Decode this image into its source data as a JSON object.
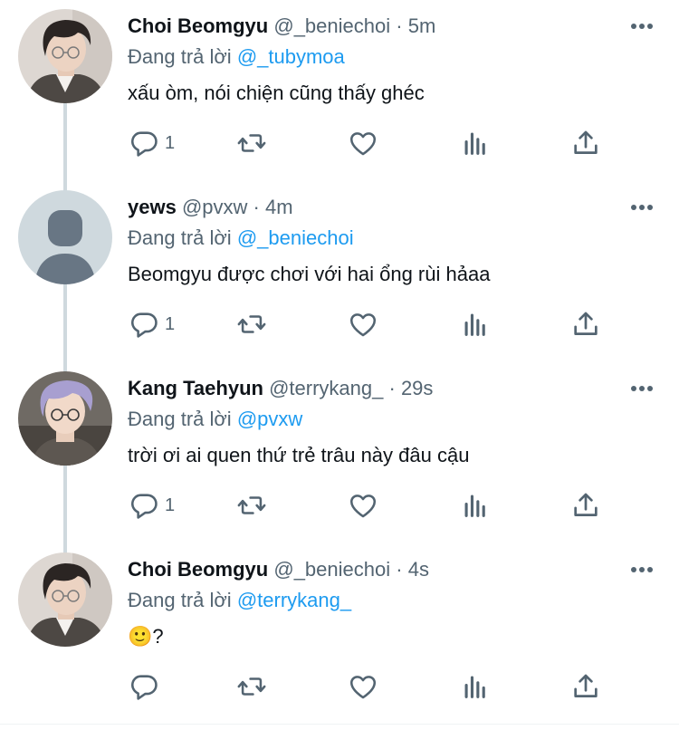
{
  "tweets": [
    {
      "name": "Choi Beomgyu",
      "handle": "@_beniechoi",
      "time": "5m",
      "reply_label": "Đang trả lời",
      "reply_to": "@_tubymoa",
      "text": "xấu òm, nói chiện cũng thấy ghéc",
      "reply_count": "1",
      "avatar": "photo-gray"
    },
    {
      "name": "yews",
      "handle": "@pvxw",
      "time": "4m",
      "reply_label": "Đang trả lời",
      "reply_to": "@_beniechoi",
      "text": "Beomgyu được chơi với hai ổng rùi hảaa",
      "reply_count": "1",
      "avatar": "default-person"
    },
    {
      "name": "Kang Taehyun",
      "handle": "@terrykang_",
      "time": "29s",
      "reply_label": "Đang trả lời",
      "reply_to": "@pvxw",
      "text": "trời ơi ai quen thứ trẻ trâu này đâu cậu",
      "reply_count": "1",
      "avatar": "photo-purple"
    },
    {
      "name": "Choi Beomgyu",
      "handle": "@_beniechoi",
      "time": "4s",
      "reply_label": "Đang trả lời",
      "reply_to": "@terrykang_",
      "text": "🙂?",
      "reply_count": "",
      "avatar": "photo-gray"
    }
  ],
  "separator": "·",
  "icons": [
    "reply-icon",
    "retweet-icon",
    "like-icon",
    "analytics-icon",
    "share-icon",
    "more-icon"
  ],
  "colors": {
    "accent": "#1d9bf0",
    "secondary": "#536471",
    "text": "#0f1419",
    "thread_line": "#cfd9de"
  }
}
